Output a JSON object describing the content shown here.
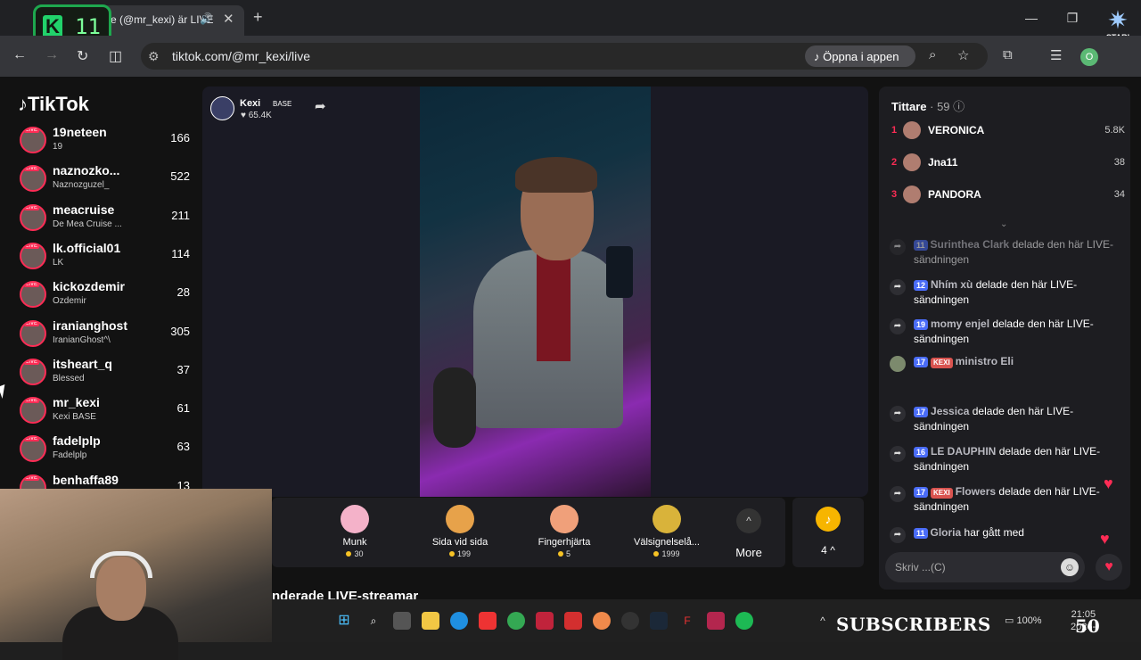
{
  "browser": {
    "tab_title": "e (@mr_kexi) är LIVE",
    "url": "tiktok.com/@mr_kexi/live",
    "open_app": "Öppna i appen",
    "profile_initial": "O"
  },
  "overlay": {
    "k_letter": "K",
    "k_number": "11",
    "star_label": "STARI",
    "subscribers": "SUBSCRIBERS",
    "big_number": "50"
  },
  "sidebar": {
    "logo": "TikTok",
    "items": [
      {
        "name": "19neteen",
        "sub": "19",
        "count": "166"
      },
      {
        "name": "naznozko...",
        "sub": "Naznozguzel_",
        "count": "522"
      },
      {
        "name": "meacruise",
        "sub": "De Mea Cruise ...",
        "count": "211"
      },
      {
        "name": "lk.official01",
        "sub": "LK",
        "count": "114"
      },
      {
        "name": "kickozdemir",
        "sub": "Ozdemir",
        "count": "28"
      },
      {
        "name": "iranianghost",
        "sub": "IranianGhost^\\",
        "count": "305"
      },
      {
        "name": "itsheart_q",
        "sub": "Blessed",
        "count": "37"
      },
      {
        "name": "mr_kexi",
        "sub": "Kexi BASE",
        "count": "61"
      },
      {
        "name": "fadelplp",
        "sub": "Fadelplp",
        "count": "63"
      },
      {
        "name": "benhaffa89",
        "sub": "",
        "count": "13"
      }
    ]
  },
  "host": {
    "name": "Kexi",
    "badge": "BASE",
    "likes": "65.4K"
  },
  "gifts": [
    {
      "name": "Munk",
      "price": "30",
      "color": "#f4b2c9"
    },
    {
      "name": "Sida vid sida",
      "price": "199",
      "color": "#e7a24a"
    },
    {
      "name": "Fingerhjärta",
      "price": "5",
      "color": "#f0a07a"
    },
    {
      "name": "Välsignelselå...",
      "price": "1999",
      "color": "#d9b33a"
    }
  ],
  "more_label": "More",
  "coins": {
    "count": "4"
  },
  "recommended_heading": "nderade LIVE-streamar",
  "chat": {
    "viewers_label": "Tittare",
    "viewers_count": "· 59",
    "top": [
      {
        "rank": "1",
        "name": "VERONICA",
        "score": "5.8K"
      },
      {
        "rank": "2",
        "name": "Jna11",
        "score": "38"
      },
      {
        "rank": "3",
        "name": "PANDORA",
        "score": "34"
      }
    ],
    "messages": [
      {
        "level": "11",
        "name": "Surinthea Clark",
        "text": "delade den här LIVE-sändningen"
      },
      {
        "level": "12",
        "name": "Nhím xù",
        "text": "delade den här LIVE-sändningen"
      },
      {
        "level": "19",
        "name": "momy enjel",
        "text": "delade den här LIVE-sändningen"
      },
      {
        "level": "17",
        "name": "ministro Eli",
        "text": "",
        "kexi": "KEXI"
      },
      {
        "level": "17",
        "name": "Jessica",
        "text": "delade den här LIVE-sändningen"
      },
      {
        "level": "16",
        "name": "LE DAUPHIN",
        "text": "delade den här LIVE-sändningen"
      },
      {
        "level": "17",
        "name": "Flowers",
        "text": "delade den här LIVE-sändningen",
        "kexi": "KEXI"
      },
      {
        "level": "11",
        "name": "Gloria",
        "text": "har gått med"
      }
    ],
    "input_placeholder": "Skriv ...(C)"
  },
  "system": {
    "battery": "100%",
    "time": "21:05",
    "date": "2026-"
  }
}
